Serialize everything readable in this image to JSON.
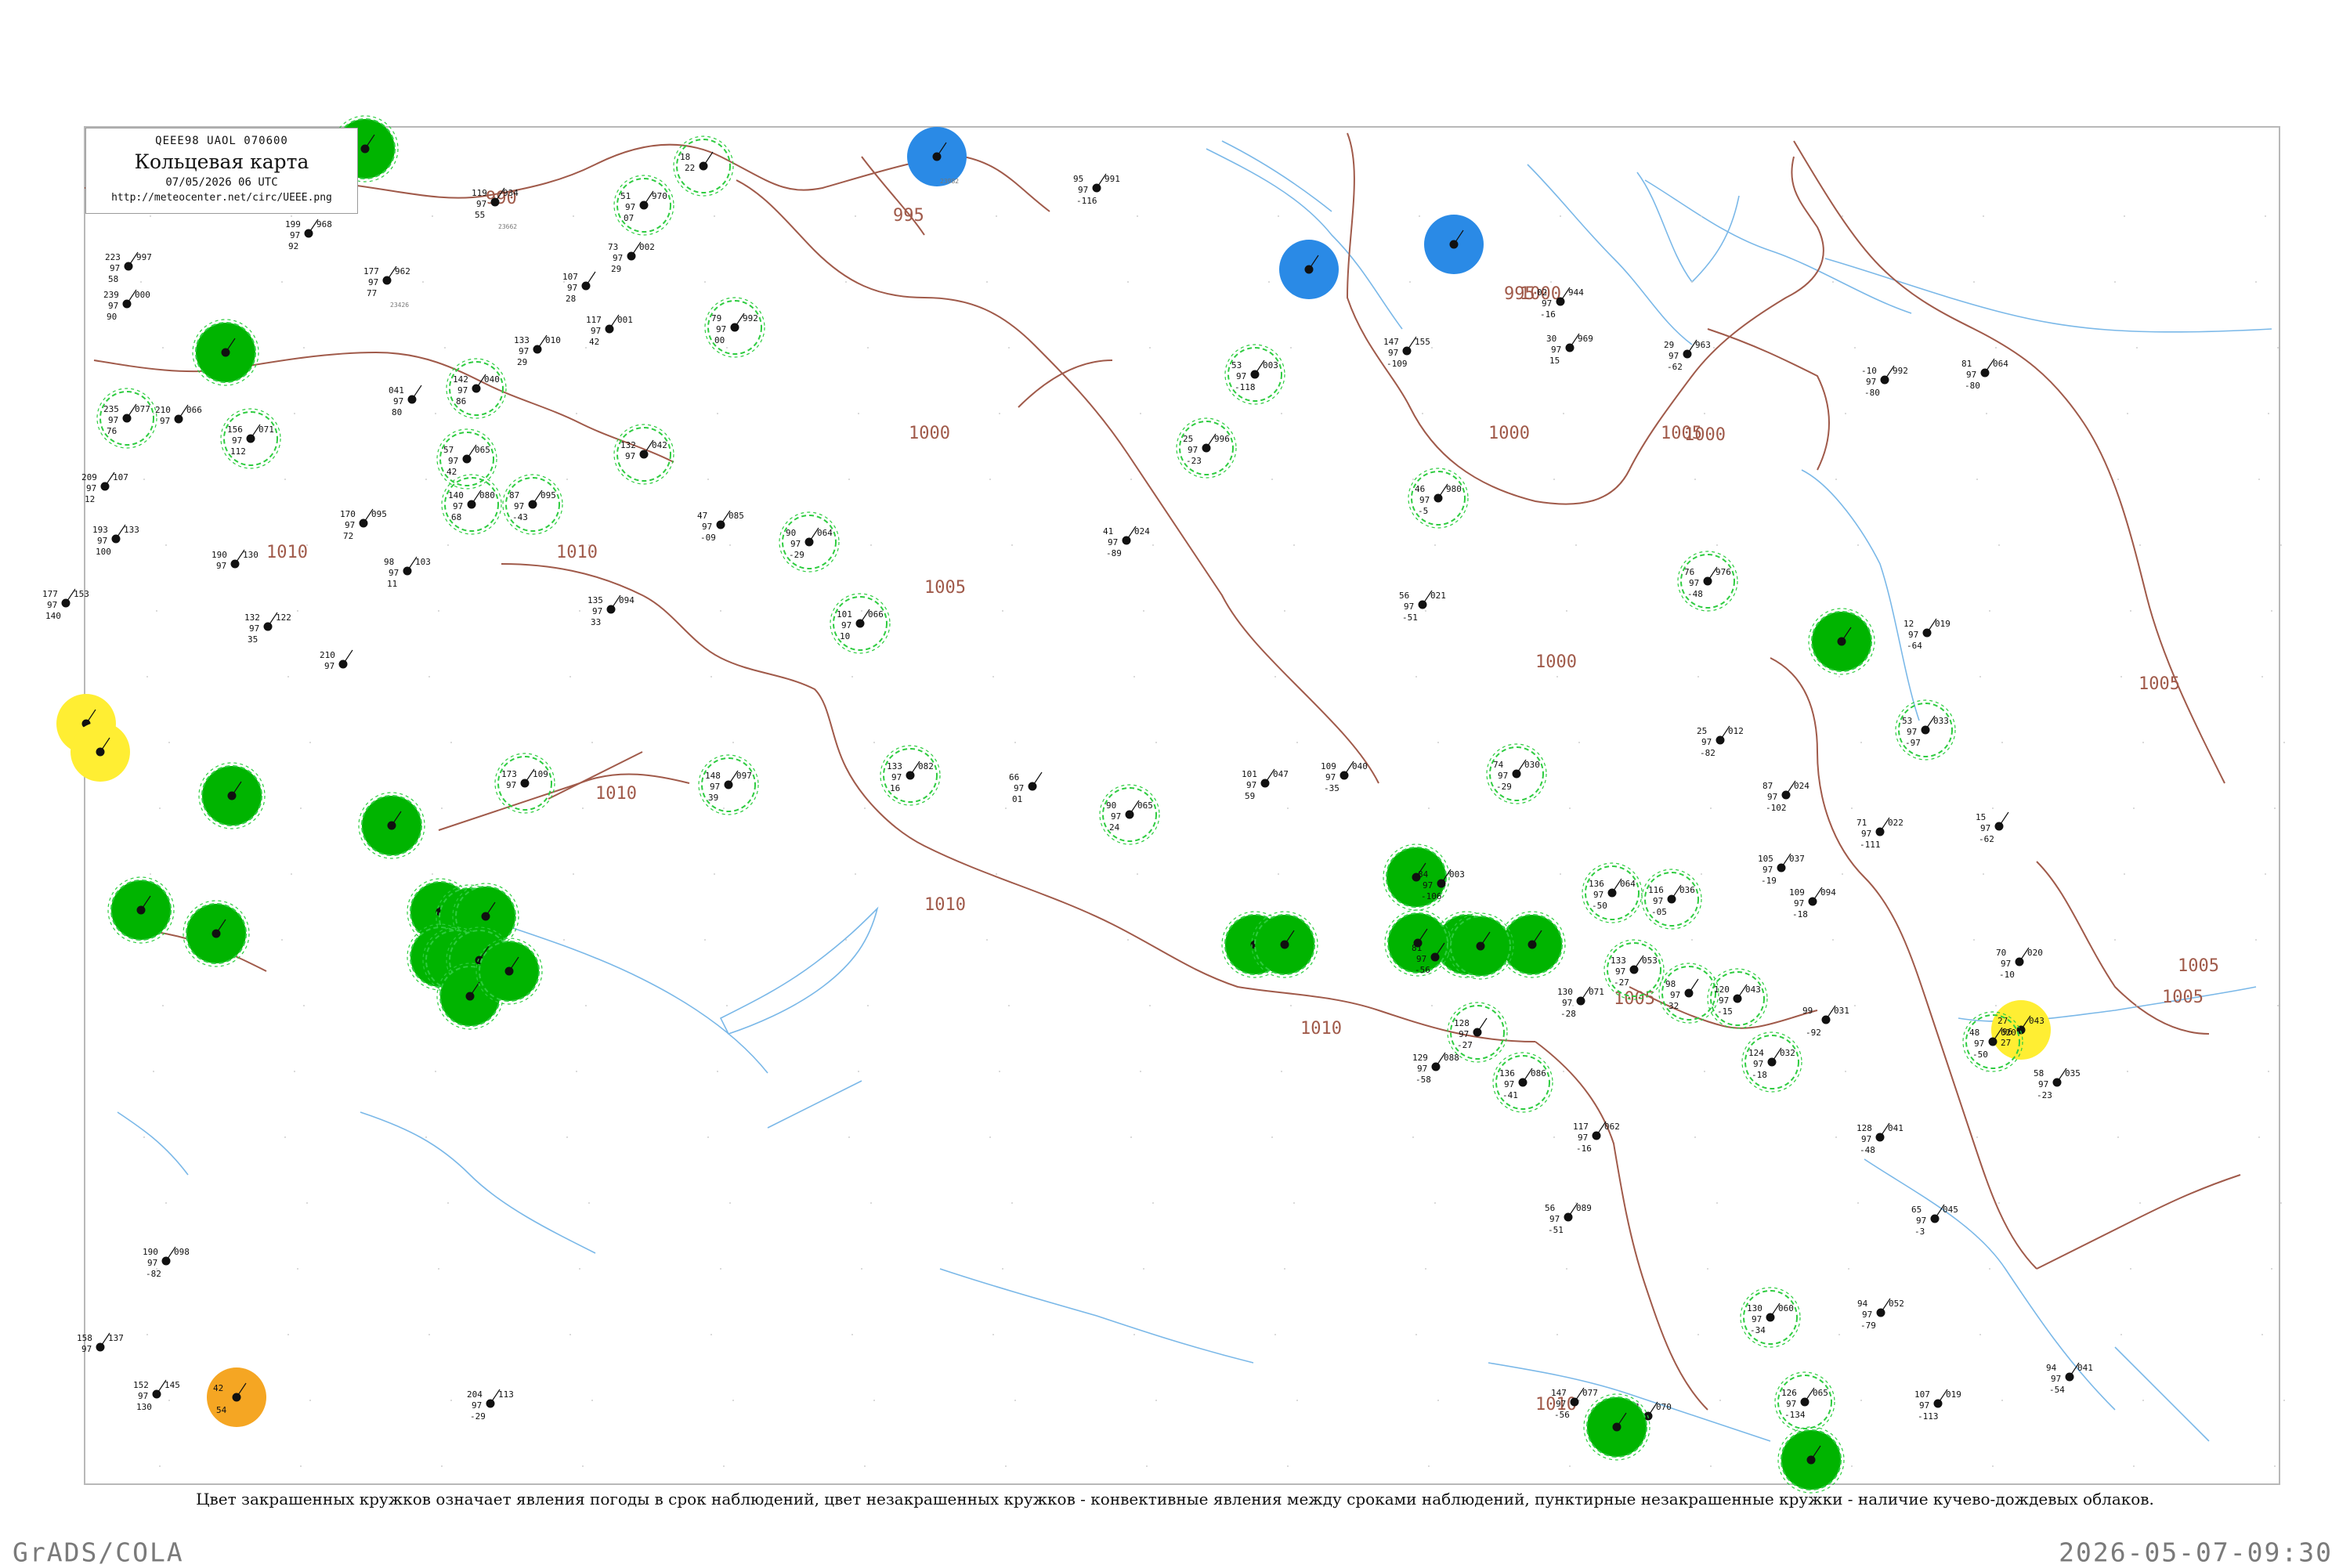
{
  "header": {
    "code_line": "QEEE98  UAOL  070600",
    "title": "Кольцевая карта",
    "datetime": "07/05/2026 06 UTC",
    "url": "http://meteocenter.net/circ/UEEE.png"
  },
  "caption": "Цвет закрашенных кружков означает явления погоды в срок наблюдений, цвет незакрашенных кружков - конвективные явления между сроками наблюдений, пунктирные незакрашенные кружки - наличие кучево-дождевых облаков.",
  "footer": {
    "left": "GrADS/COLA",
    "right": "2026-05-07-09:30"
  },
  "colors": {
    "isobar": "#a05a4a",
    "river": "#7ab8e8",
    "ring_dashed": "#2ecc40",
    "fill_green": "#00b400",
    "fill_blue": "#2a8ae6",
    "fill_yellow": "#ffee33",
    "fill_orange": "#f5a623"
  },
  "isobars": [
    {
      "label": "990"
    },
    {
      "label": "995"
    },
    {
      "label": "995"
    },
    {
      "label": "1000"
    },
    {
      "label": "1000"
    },
    {
      "label": "1000"
    },
    {
      "label": "1000"
    },
    {
      "label": "1005"
    },
    {
      "label": "1005"
    },
    {
      "label": "1005"
    },
    {
      "label": "1005"
    },
    {
      "label": "1005"
    },
    {
      "label": "1010"
    },
    {
      "label": "1010"
    },
    {
      "label": "1010"
    },
    {
      "label": "1010"
    },
    {
      "label": "1010"
    },
    {
      "label": "1000"
    },
    {
      "label": "1005"
    },
    {
      "label": "1010"
    }
  ],
  "stations": [
    {
      "t": "119",
      "p": "934",
      "td": "97",
      "tend": "55",
      "id": "23662",
      "type": "plain"
    },
    {
      "t": "199",
      "p": "968",
      "td": "97",
      "tend": "92",
      "id": "",
      "type": "plain"
    },
    {
      "t": "177",
      "p": "962",
      "td": "97",
      "tend": "77",
      "id": "23426",
      "type": "plain"
    },
    {
      "t": "107",
      "p": "",
      "td": "97",
      "tend": "28",
      "id": "",
      "type": "plain"
    },
    {
      "t": "51",
      "p": "970",
      "td": "97",
      "tend": "07",
      "id": "",
      "type": "dashed"
    },
    {
      "t": "73",
      "p": "002",
      "td": "97",
      "tend": "29",
      "id": "",
      "type": "plain"
    },
    {
      "t": "18",
      "p": "",
      "td": "22",
      "tend": "",
      "id": "",
      "type": "dashed"
    },
    {
      "t": "",
      "p": "",
      "td": "",
      "tend": "",
      "id": "",
      "type": "green"
    },
    {
      "t": "",
      "p": "",
      "td": "",
      "tend": "",
      "id": "23982",
      "type": "blue"
    },
    {
      "t": "95",
      "p": "991",
      "td": "97",
      "tend": "-116",
      "id": "",
      "type": "plain"
    },
    {
      "t": "",
      "p": "",
      "td": "",
      "tend": "",
      "id": "",
      "type": "blue"
    },
    {
      "t": "",
      "p": "",
      "td": "",
      "tend": "",
      "id": "",
      "type": "blue"
    },
    {
      "t": "02",
      "p": "944",
      "td": "97",
      "tend": "-16",
      "id": "",
      "type": "plain"
    },
    {
      "t": "223",
      "p": "997",
      "td": "97",
      "tend": "58",
      "id": "",
      "type": "plain"
    },
    {
      "t": "239",
      "p": "000",
      "td": "97",
      "tend": "90",
      "id": "",
      "type": "plain"
    },
    {
      "t": "",
      "p": "",
      "td": "",
      "tend": "",
      "id": "",
      "type": "green"
    },
    {
      "t": "133",
      "p": "010",
      "td": "97",
      "tend": "29",
      "id": "",
      "type": "plain"
    },
    {
      "t": "117",
      "p": "001",
      "td": "97",
      "tend": "42",
      "id": "",
      "type": "plain"
    },
    {
      "t": "79",
      "p": "992",
      "td": "97",
      "tend": "00",
      "id": "",
      "type": "dashed"
    },
    {
      "t": "142",
      "p": "040",
      "td": "97",
      "tend": "86",
      "id": "",
      "type": "dashed"
    },
    {
      "t": "53",
      "p": "003",
      "td": "97",
      "tend": "-118",
      "id": "",
      "type": "dashed"
    },
    {
      "t": "147",
      "p": "155",
      "td": "97",
      "tend": "-109",
      "id": "",
      "type": "plain"
    },
    {
      "t": "30",
      "p": "969",
      "td": "97",
      "tend": "15",
      "id": "",
      "type": "plain"
    },
    {
      "t": "29",
      "p": "963",
      "td": "97",
      "tend": "-62",
      "id": "",
      "type": "plain"
    },
    {
      "t": "-10",
      "p": "992",
      "td": "97",
      "tend": "-80",
      "id": "",
      "type": "plain"
    },
    {
      "t": "81",
      "p": "064",
      "td": "97",
      "tend": "-80",
      "id": "",
      "type": "plain"
    },
    {
      "t": "235",
      "p": "077",
      "td": "97",
      "tend": "76",
      "id": "",
      "type": "dashed"
    },
    {
      "t": "210",
      "p": "066",
      "td": "97",
      "tend": "",
      "id": "",
      "type": "plain"
    },
    {
      "t": "156",
      "p": "071",
      "td": "97",
      "tend": "112",
      "id": "",
      "type": "dashed"
    },
    {
      "t": "041",
      "p": "",
      "td": "97",
      "tend": "80",
      "id": "",
      "type": "plain"
    },
    {
      "t": "57",
      "p": "065",
      "td": "97",
      "tend": "42",
      "id": "",
      "type": "dashed"
    },
    {
      "t": "132",
      "p": "042",
      "td": "97",
      "tend": "",
      "id": "",
      "type": "dashed"
    },
    {
      "t": "25",
      "p": "996",
      "td": "97",
      "tend": "-23",
      "id": "",
      "type": "dashed"
    },
    {
      "t": "46",
      "p": "980",
      "td": "97",
      "tend": "-5",
      "id": "",
      "type": "dashed"
    },
    {
      "t": "209",
      "p": "107",
      "td": "97",
      "tend": "12",
      "id": "",
      "type": "plain"
    },
    {
      "t": "140",
      "p": "080",
      "td": "97",
      "tend": "68",
      "id": "",
      "type": "dashed"
    },
    {
      "t": "87",
      "p": "095",
      "td": "97",
      "tend": "-43",
      "id": "",
      "type": "dashed"
    },
    {
      "t": "170",
      "p": "095",
      "td": "97",
      "tend": "72",
      "id": "",
      "type": "plain"
    },
    {
      "t": "47",
      "p": "085",
      "td": "97",
      "tend": "-09",
      "id": "",
      "type": "plain"
    },
    {
      "t": "90",
      "p": "064",
      "td": "97",
      "tend": "-29",
      "id": "",
      "type": "dashed"
    },
    {
      "t": "41",
      "p": "024",
      "td": "97",
      "tend": "-89",
      "id": "",
      "type": "plain"
    },
    {
      "t": "76",
      "p": "976",
      "td": "97",
      "tend": "-48",
      "id": "",
      "type": "dashed"
    },
    {
      "t": "193",
      "p": "133",
      "td": "97",
      "tend": "100",
      "id": "",
      "type": "plain"
    },
    {
      "t": "190",
      "p": "130",
      "td": "97",
      "tend": "",
      "id": "",
      "type": "plain"
    },
    {
      "t": "98",
      "p": "103",
      "td": "97",
      "tend": "11",
      "id": "",
      "type": "plain"
    },
    {
      "t": "135",
      "p": "094",
      "td": "97",
      "tend": "33",
      "id": "",
      "type": "plain"
    },
    {
      "t": "101",
      "p": "066",
      "td": "97",
      "tend": "10",
      "id": "",
      "type": "dashed"
    },
    {
      "t": "56",
      "p": "021",
      "td": "97",
      "tend": "-51",
      "id": "",
      "type": "plain"
    },
    {
      "t": "12",
      "p": "019",
      "td": "97",
      "tend": "-64",
      "id": "",
      "type": "plain"
    },
    {
      "t": "177",
      "p": "153",
      "td": "97",
      "tend": "140",
      "id": "",
      "type": "plain"
    },
    {
      "t": "132",
      "p": "122",
      "td": "97",
      "tend": "35",
      "id": "",
      "type": "plain"
    },
    {
      "t": "210",
      "p": "",
      "td": "97",
      "tend": "",
      "id": "",
      "type": "plain"
    },
    {
      "t": "",
      "p": "",
      "td": "",
      "tend": "",
      "id": "",
      "type": "yellow"
    },
    {
      "t": "",
      "p": "",
      "td": "",
      "tend": "",
      "id": "",
      "type": "yellow"
    },
    {
      "t": "148",
      "p": "097",
      "td": "97",
      "tend": "39",
      "id": "",
      "type": "dashed"
    },
    {
      "t": "173",
      "p": "109",
      "td": "97",
      "tend": "",
      "id": "",
      "type": "dashed"
    },
    {
      "t": "133",
      "p": "082",
      "td": "97",
      "tend": "16",
      "id": "",
      "type": "dashed"
    },
    {
      "t": "66",
      "p": "",
      "td": "97",
      "tend": "01",
      "id": "",
      "type": "plain"
    },
    {
      "t": "90",
      "p": "065",
      "td": "97",
      "tend": "24",
      "id": "",
      "type": "dashed"
    },
    {
      "t": "101",
      "p": "047",
      "td": "97",
      "tend": "59",
      "id": "",
      "type": "plain"
    },
    {
      "t": "109",
      "p": "040",
      "td": "97",
      "tend": "-35",
      "id": "",
      "type": "plain"
    },
    {
      "t": "74",
      "p": "030",
      "td": "97",
      "tend": "-29",
      "id": "",
      "type": "dashed"
    },
    {
      "t": "25",
      "p": "012",
      "td": "97",
      "tend": "-82",
      "id": "",
      "type": "plain"
    },
    {
      "t": "53",
      "p": "033",
      "td": "97",
      "tend": "-97",
      "id": "",
      "type": "dashed"
    },
    {
      "t": "",
      "p": "",
      "td": "",
      "tend": "",
      "id": "",
      "type": "green"
    },
    {
      "t": "",
      "p": "",
      "td": "",
      "tend": "",
      "id": "",
      "type": "green"
    },
    {
      "t": "",
      "p": "",
      "td": "",
      "tend": "",
      "id": "",
      "type": "green"
    },
    {
      "t": "",
      "p": "",
      "td": "",
      "tend": "",
      "id": "",
      "type": "green"
    },
    {
      "t": "",
      "p": "",
      "td": "",
      "tend": "",
      "id": "",
      "type": "green"
    },
    {
      "t": "",
      "p": "",
      "td": "",
      "tend": "",
      "id": "",
      "type": "green"
    },
    {
      "t": "",
      "p": "",
      "td": "",
      "tend": "",
      "id": "",
      "type": "green"
    },
    {
      "t": "",
      "p": "",
      "td": "",
      "tend": "",
      "id": "",
      "type": "green"
    },
    {
      "t": "",
      "p": "",
      "td": "",
      "tend": "",
      "id": "",
      "type": "green"
    },
    {
      "t": "",
      "p": "",
      "td": "",
      "tend": "",
      "id": "",
      "type": "green"
    },
    {
      "t": "",
      "p": "",
      "td": "",
      "tend": "",
      "id": "",
      "type": "green"
    },
    {
      "t": "",
      "p": "",
      "td": "",
      "tend": "",
      "id": "",
      "type": "green"
    },
    {
      "t": "",
      "p": "",
      "td": "",
      "tend": "",
      "id": "",
      "type": "green"
    },
    {
      "t": "",
      "p": "",
      "td": "",
      "tend": "",
      "id": "",
      "type": "green"
    },
    {
      "t": "",
      "p": "",
      "td": "",
      "tend": "",
      "id": "",
      "type": "green"
    },
    {
      "t": "",
      "p": "",
      "td": "",
      "tend": "",
      "id": "",
      "type": "green"
    },
    {
      "t": "",
      "p": "",
      "td": "",
      "tend": "",
      "id": "",
      "type": "green"
    },
    {
      "t": "",
      "p": "",
      "td": "",
      "tend": "",
      "id": "",
      "type": "green"
    },
    {
      "t": "27",
      "p": "043",
      "td": "96",
      "tend": "27",
      "id": "",
      "type": "yellow"
    },
    {
      "t": "42",
      "p": "",
      "td": "",
      "tend": "54",
      "id": "",
      "type": "orange"
    },
    {
      "t": "158",
      "p": "137",
      "td": "97",
      "tend": "",
      "id": "",
      "type": "plain"
    },
    {
      "t": "152",
      "p": "145",
      "td": "97",
      "tend": "130",
      "id": "",
      "type": "plain"
    },
    {
      "t": "190",
      "p": "098",
      "td": "97",
      "tend": "-82",
      "id": "",
      "type": "plain"
    },
    {
      "t": "204",
      "p": "113",
      "td": "97",
      "tend": "-29",
      "id": "",
      "type": "plain"
    },
    {
      "t": "147",
      "p": "077",
      "td": "97",
      "tend": "-56",
      "id": "",
      "type": "plain"
    },
    {
      "t": "101",
      "p": "070",
      "td": "97",
      "tend": "-31",
      "id": "",
      "type": "plain"
    },
    {
      "t": "126",
      "p": "065",
      "td": "97",
      "tend": "-134",
      "id": "",
      "type": "dashed"
    },
    {
      "t": "107",
      "p": "019",
      "td": "97",
      "tend": "-113",
      "id": "",
      "type": "plain"
    },
    {
      "t": "94",
      "p": "041",
      "td": "97",
      "tend": "-54",
      "id": "",
      "type": "plain"
    },
    {
      "t": "130",
      "p": "060",
      "td": "97",
      "tend": "-34",
      "id": "",
      "type": "dashed"
    },
    {
      "t": "94",
      "p": "052",
      "td": "97",
      "tend": "-79",
      "id": "",
      "type": "plain"
    },
    {
      "t": "65",
      "p": "045",
      "td": "97",
      "tend": "-3",
      "id": "",
      "type": "plain"
    },
    {
      "t": "58",
      "p": "035",
      "td": "97",
      "tend": "-23",
      "id": "",
      "type": "plain"
    },
    {
      "t": "70",
      "p": "020",
      "td": "97",
      "tend": "-10",
      "id": "",
      "type": "plain"
    },
    {
      "t": "99",
      "p": "031",
      "td": "",
      "tend": "-92",
      "id": "",
      "type": "plain"
    },
    {
      "t": "128",
      "p": "041",
      "td": "97",
      "tend": "-48",
      "id": "",
      "type": "plain"
    },
    {
      "t": "117",
      "p": "062",
      "td": "97",
      "tend": "-16",
      "id": "",
      "type": "plain"
    },
    {
      "t": "56",
      "p": "089",
      "td": "97",
      "tend": "-51",
      "id": "",
      "type": "plain"
    },
    {
      "t": "136",
      "p": "086",
      "td": "97",
      "tend": "-41",
      "id": "",
      "type": "dashed"
    },
    {
      "t": "129",
      "p": "088",
      "td": "97",
      "tend": "-58",
      "id": "",
      "type": "plain"
    },
    {
      "t": "81",
      "p": "",
      "td": "97",
      "tend": "-56",
      "id": "",
      "type": "plain"
    },
    {
      "t": "128",
      "p": "",
      "td": "97",
      "tend": "-27",
      "id": "",
      "type": "dashed"
    },
    {
      "t": "130",
      "p": "071",
      "td": "97",
      "tend": "-28",
      "id": "",
      "type": "plain"
    },
    {
      "t": "133",
      "p": "053",
      "td": "97",
      "tend": "-27",
      "id": "",
      "type": "dashed"
    },
    {
      "t": "98",
      "p": "",
      "td": "97",
      "tend": "32",
      "id": "",
      "type": "dashed"
    },
    {
      "t": "120",
      "p": "043",
      "td": "97",
      "tend": "-15",
      "id": "",
      "type": "dashed"
    },
    {
      "t": "124",
      "p": "032",
      "td": "97",
      "tend": "-18",
      "id": "",
      "type": "dashed"
    },
    {
      "t": "136",
      "p": "064",
      "td": "97",
      "tend": "-50",
      "id": "",
      "type": "dashed"
    },
    {
      "t": "116",
      "p": "036",
      "td": "97",
      "tend": "-05",
      "id": "",
      "type": "dashed"
    },
    {
      "t": "109",
      "p": "094",
      "td": "97",
      "tend": "-18",
      "id": "",
      "type": "plain"
    },
    {
      "t": "105",
      "p": "037",
      "td": "97",
      "tend": "-19",
      "id": "",
      "type": "plain"
    },
    {
      "t": "87",
      "p": "024",
      "td": "97",
      "tend": "-102",
      "id": "",
      "type": "plain"
    },
    {
      "t": "71",
      "p": "022",
      "td": "97",
      "tend": "-111",
      "id": "",
      "type": "plain"
    },
    {
      "t": "15",
      "p": "",
      "td": "97",
      "tend": "-62",
      "id": "",
      "type": "plain"
    },
    {
      "t": "48",
      "p": "020",
      "td": "97",
      "tend": "-50",
      "id": "",
      "type": "dashed"
    },
    {
      "t": "84",
      "p": "003",
      "td": "97",
      "tend": "-106",
      "id": "",
      "type": "plain"
    },
    {
      "t": "",
      "p": "",
      "td": "",
      "tend": "",
      "id": "",
      "type": "green"
    },
    {
      "t": "",
      "p": "",
      "td": "",
      "tend": "",
      "id": "",
      "type": "green"
    },
    {
      "t": "",
      "p": "",
      "td": "",
      "tend": "",
      "id": "",
      "type": "green"
    },
    {
      "t": "",
      "p": "",
      "td": "",
      "tend": "",
      "id": "",
      "type": "green"
    }
  ]
}
